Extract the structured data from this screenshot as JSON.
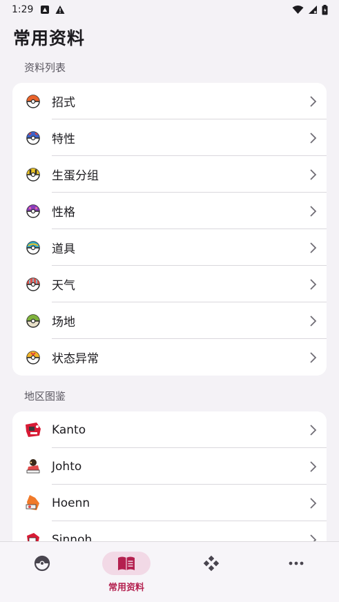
{
  "status": {
    "time": "1:29"
  },
  "page": {
    "title": "常用资料"
  },
  "sections": [
    {
      "header": "资料列表",
      "items": [
        {
          "label": "招式",
          "icon": "poke-ball-icon",
          "color": "#e9632b"
        },
        {
          "label": "特性",
          "icon": "great-ball-icon",
          "color": "#3d63c9"
        },
        {
          "label": "生蛋分组",
          "icon": "ultra-ball-icon",
          "color": "#e8c227"
        },
        {
          "label": "性格",
          "icon": "master-ball-icon",
          "color": "#8a3dbb"
        },
        {
          "label": "道具",
          "icon": "dive-ball-icon",
          "color": "#2ea6c4"
        },
        {
          "label": "天气",
          "icon": "net-ball-icon",
          "color": "#e0524a"
        },
        {
          "label": "场地",
          "icon": "nest-ball-icon",
          "color": "#7fb23c"
        },
        {
          "label": "状态异常",
          "icon": "fast-ball-icon",
          "color": "#f0b52a"
        }
      ]
    },
    {
      "header": "地区图鉴",
      "items": [
        {
          "label": "Kanto",
          "icon": "kanto-region-icon"
        },
        {
          "label": "Johto",
          "icon": "johto-region-icon"
        },
        {
          "label": "Hoenn",
          "icon": "hoenn-region-icon"
        },
        {
          "label": "Sinnoh",
          "icon": "sinnoh-region-icon"
        }
      ]
    }
  ],
  "bottom_nav": {
    "items": [
      {
        "icon": "pokeball-nav-icon",
        "label": ""
      },
      {
        "icon": "book-nav-icon",
        "label": "常用资料",
        "active": true
      },
      {
        "icon": "gamepad-nav-icon",
        "label": ""
      },
      {
        "icon": "more-nav-icon",
        "label": ""
      }
    ]
  },
  "colors": {
    "accent": "#b4204f",
    "active_pill": "#f2d9e6",
    "background": "#f4f2f6"
  }
}
